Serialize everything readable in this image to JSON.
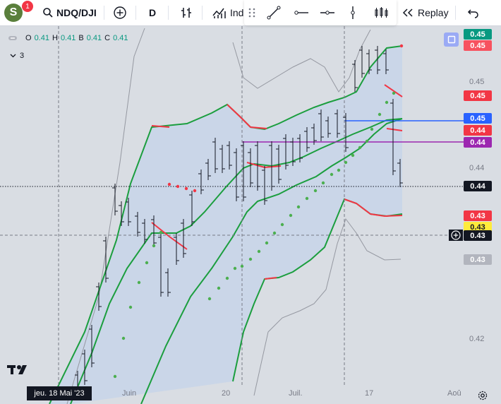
{
  "toolbar": {
    "avatar_letter": "S",
    "notification_count": "1",
    "symbol": "NDQ/DJI",
    "interval": "D",
    "indicators_label": "Ind",
    "replay_label": "Replay"
  },
  "legend": {
    "o_label": "O",
    "o_value": "0.41",
    "h_label": "H",
    "h_value": "0.41",
    "b_label": "B",
    "b_value": "0.41",
    "c_label": "C",
    "c_value": "0.41",
    "indicator_count": "3"
  },
  "price_axis": {
    "labels": [
      "0.45",
      "0.44",
      "0.42"
    ],
    "badges": [
      {
        "value": "0.45",
        "color": "#089981"
      },
      {
        "value": "0.45",
        "color": "#f7525f"
      },
      {
        "value": "0.45",
        "color": "#f23645"
      },
      {
        "value": "0.45",
        "color": "#2962ff"
      },
      {
        "value": "0.44",
        "color": "#f23645"
      },
      {
        "value": "0.44",
        "color": "#9c27b0"
      },
      {
        "value": "0.44",
        "color": "#131722"
      },
      {
        "value": "0.43",
        "color": "#f23645"
      },
      {
        "value": "0.43",
        "color": "#ffeb3b"
      },
      {
        "value": "0.43",
        "color": "#131722"
      },
      {
        "value": "0.43",
        "color": "#b2b5be"
      }
    ]
  },
  "time_axis": {
    "labels": [
      "Juin",
      "20",
      "Juil.",
      "17",
      "Aoû"
    ],
    "crosshair_date": "jeu. 18 Mai '23"
  },
  "colors": {
    "band_green": "#1b9e3e",
    "band_red": "#f23645",
    "band_fill": "#c7d5e9",
    "grey_line": "#9598a1",
    "blue_line": "#2962ff",
    "purple_line": "#9c27b0",
    "psar_dots": "#4caf50"
  }
}
